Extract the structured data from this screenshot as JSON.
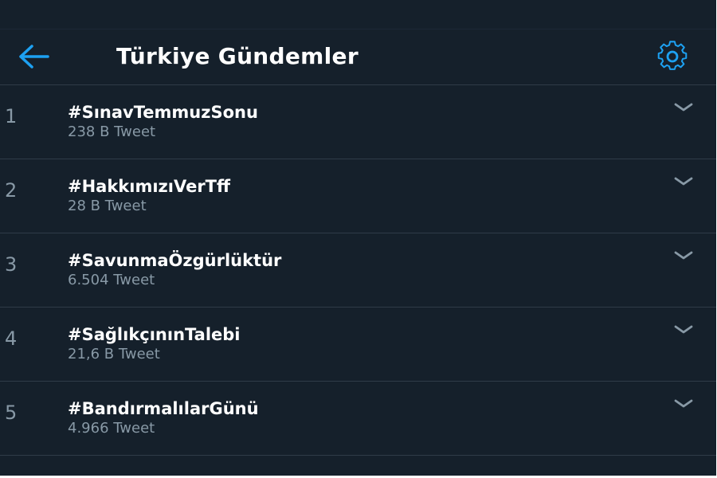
{
  "header": {
    "title": "Türkiye Gündemler",
    "back_icon": "arrow-left-icon",
    "settings_icon": "gear-icon"
  },
  "colors": {
    "background": "#15202b",
    "accent": "#1da1f2",
    "divider": "#2f3b48",
    "muted_text": "#8899a6",
    "primary_text": "#ffffff"
  },
  "trends": [
    {
      "rank": "1",
      "name": "#SınavTemmuzSonu",
      "count": "238 B Tweet"
    },
    {
      "rank": "2",
      "name": "#HakkımızıVerTff",
      "count": "28 B Tweet"
    },
    {
      "rank": "3",
      "name": "#SavunmaÖzgürlüktür",
      "count": "6.504 Tweet"
    },
    {
      "rank": "4",
      "name": "#SağlıkçınınTalebi",
      "count": "21,6 B Tweet"
    },
    {
      "rank": "5",
      "name": "#BandırmalılarGünü",
      "count": "4.966 Tweet"
    }
  ]
}
